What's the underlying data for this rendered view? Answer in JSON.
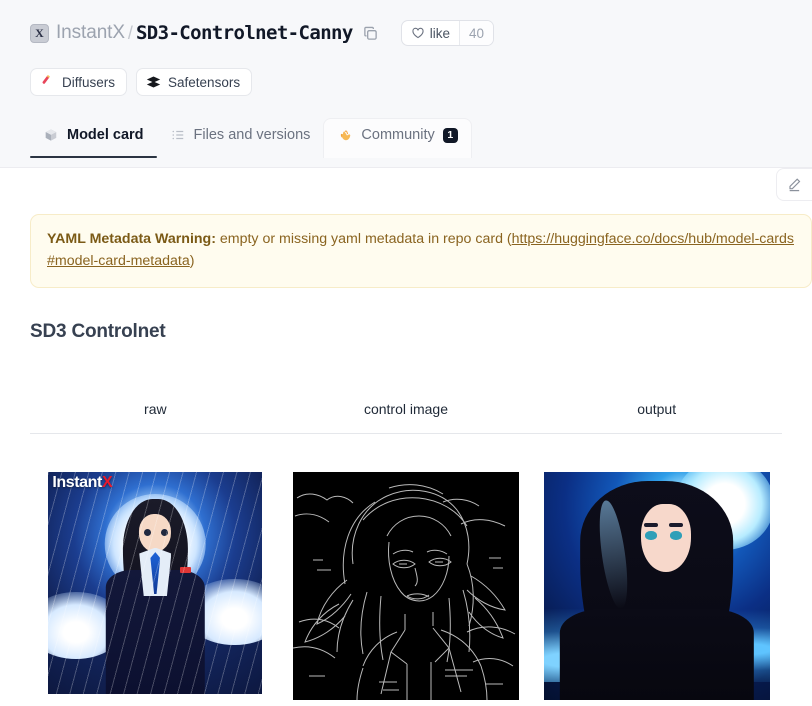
{
  "header": {
    "avatar_letter": "X",
    "org": "InstantX",
    "separator": "/",
    "repo": "SD3-Controlnet-Canny",
    "copy_icon": "copy-icon",
    "like_label": "like",
    "like_count": "40",
    "heart_icon": "heart-outline-icon"
  },
  "tags": [
    {
      "label": "Diffusers",
      "icon": "diffusers-icon"
    },
    {
      "label": "Safetensors",
      "icon": "safetensors-icon"
    }
  ],
  "tabs": [
    {
      "label": "Model card",
      "icon": "cube-icon",
      "active": true,
      "badge": ""
    },
    {
      "label": "Files and versions",
      "icon": "file-list-icon",
      "active": false,
      "badge": ""
    },
    {
      "label": "Community",
      "icon": "clapping-hands-icon",
      "active": false,
      "badge": "1"
    }
  ],
  "edit_button": {
    "icon": "pencil-icon",
    "title": "Edit"
  },
  "warning": {
    "label": "YAML Metadata Warning:",
    "text_before": " empty or missing yaml metadata in repo card (",
    "link": "https://huggingface.co/docs/hub/model-cards#model-card-metadata",
    "text_after": ")"
  },
  "section": {
    "title": "SD3 Controlnet"
  },
  "table": {
    "headers": [
      "raw",
      "control image",
      "output"
    ],
    "row": [
      {
        "kind": "raw-image",
        "watermark_prefix": "Instant",
        "watermark_accent": "X",
        "description": "anime woman in dark navy suit with blue tie under a full moon in the rain"
      },
      {
        "kind": "canny-edge-image",
        "description": "canny edge map, white outlines on black background of a woman with long flowing hair"
      },
      {
        "kind": "output-image",
        "description": "generated anime woman with long black hair, black blazer and white shirt under a blue moon"
      }
    ]
  },
  "colors": {
    "header_bg": "#f7f8fa",
    "page_bg": "#ffffff",
    "active_tab_underline": "#2b3442",
    "warning_bg": "#fffcef",
    "warning_border": "#f7ecc8",
    "warning_text": "#8a6420",
    "badge_bg": "#111827",
    "watermark_accent": "#e8192c",
    "title_text": "#111827",
    "muted_text": "#9ca3af"
  }
}
